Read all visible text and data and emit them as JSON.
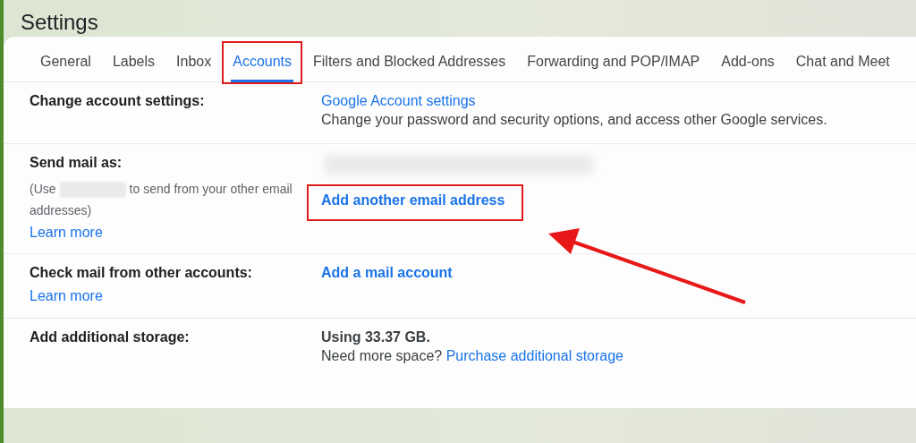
{
  "window": {
    "title": "Settings"
  },
  "tabs": [
    {
      "label": "General",
      "selected": false,
      "highlighted": false
    },
    {
      "label": "Labels",
      "selected": false,
      "highlighted": false
    },
    {
      "label": "Inbox",
      "selected": false,
      "highlighted": false
    },
    {
      "label": "Accounts",
      "selected": true,
      "highlighted": true
    },
    {
      "label": "Filters and Blocked Addresses",
      "selected": false,
      "highlighted": false
    },
    {
      "label": "Forwarding and POP/IMAP",
      "selected": false,
      "highlighted": false
    },
    {
      "label": "Add-ons",
      "selected": false,
      "highlighted": false
    },
    {
      "label": "Chat and Meet",
      "selected": false,
      "highlighted": false
    }
  ],
  "sections": [
    {
      "label": "Change account settings:",
      "items": [
        {
          "kind": "link",
          "text": "Google Account settings"
        },
        {
          "kind": "text",
          "text": "Change your password and security options, and access other Google services."
        }
      ]
    },
    {
      "label": "Send mail as:",
      "note": {
        "before": "(Use",
        "redacted": true,
        "after": "to send from your other email addresses)"
      },
      "learn_more": "Learn more",
      "items": [
        {
          "kind": "redacted"
        },
        {
          "kind": "strong-link",
          "text": "Add another email address",
          "highlighted": true
        }
      ]
    },
    {
      "label": "Check mail from other accounts:",
      "learn_more": "Learn more",
      "items": [
        {
          "kind": "strong-link",
          "text": "Add a mail account",
          "highlighted": false
        }
      ]
    },
    {
      "label": "Add additional storage:",
      "items": [
        {
          "kind": "strong",
          "text": "Using 33.37 GB."
        },
        {
          "kind": "prompt",
          "text": "Need more space?",
          "link": "Purchase additional storage"
        }
      ]
    }
  ],
  "callout_arrow": true
}
